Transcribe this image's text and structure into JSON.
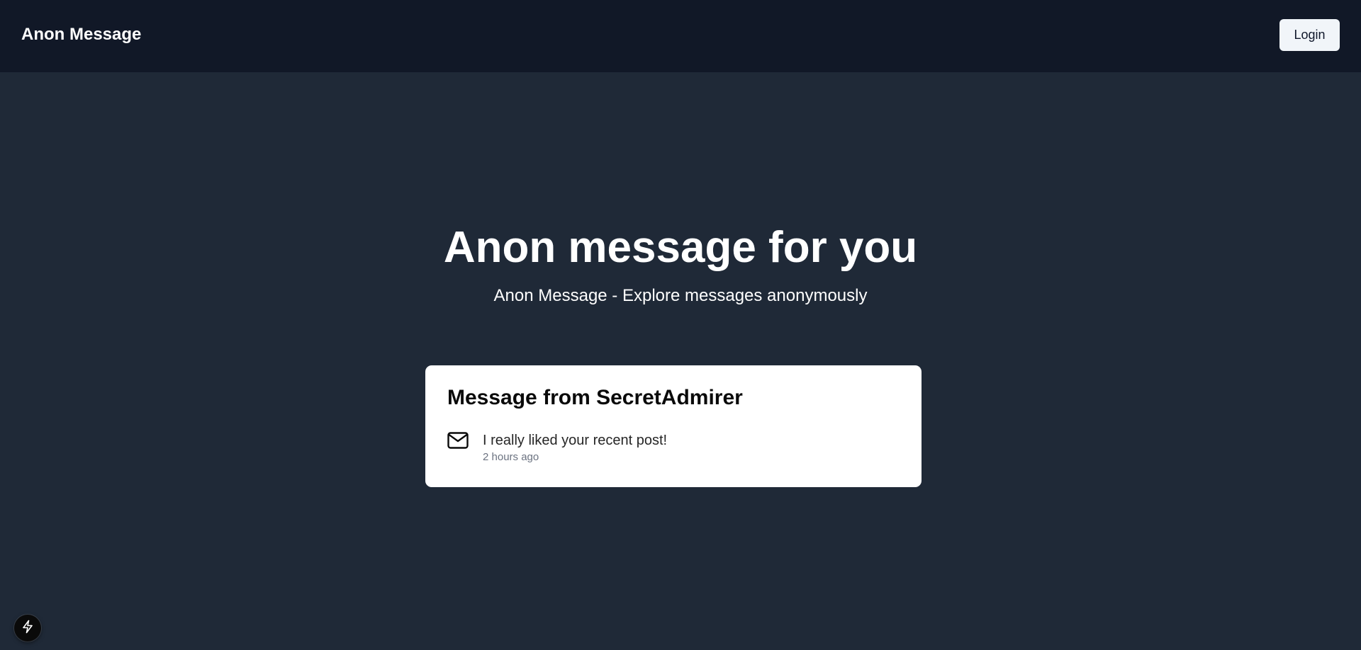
{
  "navbar": {
    "brand": "Anon Message",
    "login_label": "Login"
  },
  "hero": {
    "title": "Anon message for you",
    "subtitle": "Anon Message - Explore messages anonymously"
  },
  "message_card": {
    "title": "Message from SecretAdmirer",
    "icon": "mail-icon",
    "text": "I really liked your recent post!",
    "time": "2 hours ago"
  },
  "dev_indicator": {
    "icon": "lightning-icon"
  },
  "colors": {
    "navbar_bg": "#111827",
    "page_bg": "#1f2937",
    "card_bg": "#ffffff",
    "button_bg": "#f1f5f9"
  }
}
